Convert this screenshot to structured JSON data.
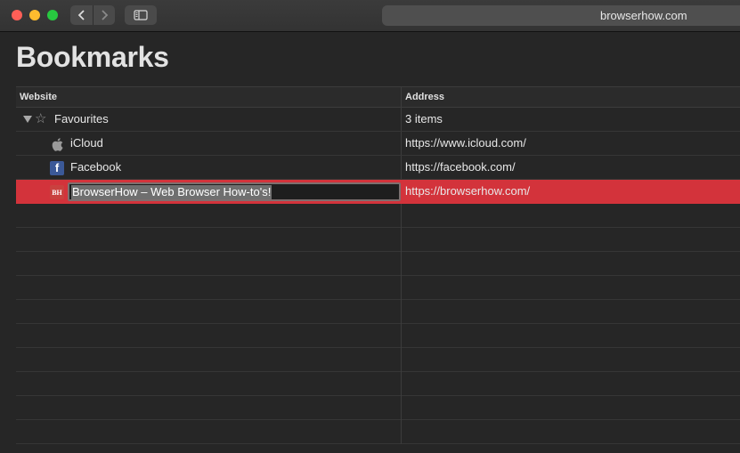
{
  "toolbar": {
    "address": "browserhow.com",
    "back_icon": "chevron-left-icon",
    "forward_icon": "chevron-right-icon",
    "sidebar_icon": "sidebar-icon"
  },
  "page": {
    "title": "Bookmarks"
  },
  "table": {
    "columns": [
      "Website",
      "Address"
    ],
    "folder": {
      "name": "Favourites",
      "count": "3 items",
      "icon": "star-icon"
    },
    "bookmarks": [
      {
        "name": "iCloud",
        "address": "https://www.icloud.com/",
        "icon": "apple-icon"
      },
      {
        "name": "Facebook",
        "address": "https://facebook.com/",
        "icon": "facebook-icon",
        "icon_glyph": "f"
      },
      {
        "name": "BrowserHow – Web Browser How-to's!",
        "address": "https://browserhow.com/",
        "icon": "browserhow-icon",
        "icon_glyph": "BH",
        "editing": true
      }
    ]
  },
  "colors": {
    "selection": "#d3333b",
    "background": "#262626"
  }
}
